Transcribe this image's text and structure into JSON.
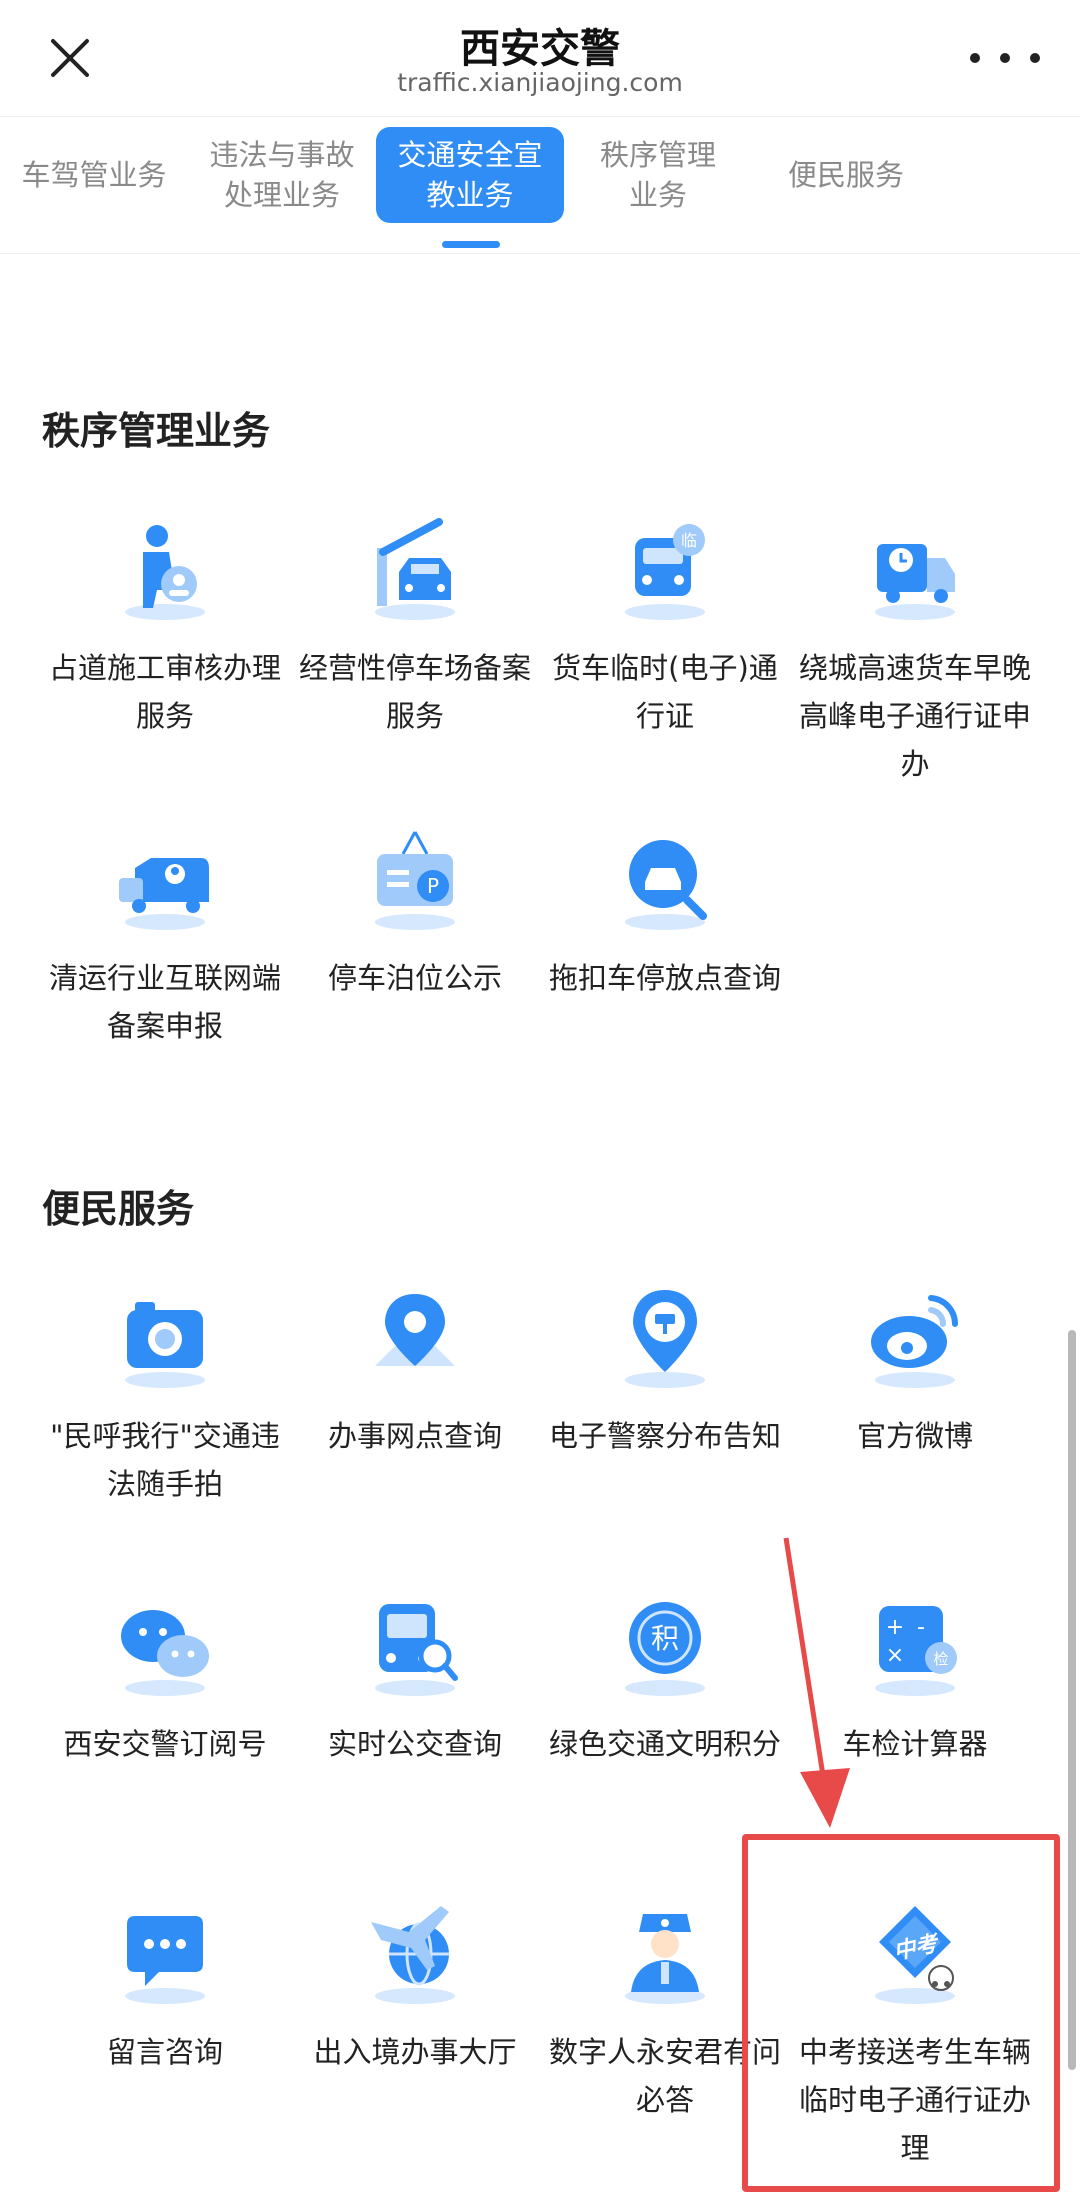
{
  "header": {
    "title": "西安交警",
    "url": "traffic.xianjiaojing.com"
  },
  "tabs": [
    {
      "label": "车驾管业务"
    },
    {
      "label": "违法与事故\n处理业务"
    },
    {
      "label": "交通安全宣\n教业务"
    },
    {
      "label": "秩序管理\n业务"
    },
    {
      "label": "便民服务"
    }
  ],
  "sections": [
    {
      "title": "秩序管理业务",
      "items": [
        {
          "label": "占道施工审核办理服务",
          "icon": "construction-worker-icon"
        },
        {
          "label": "经营性停车场备案服务",
          "icon": "parking-gate-icon"
        },
        {
          "label": "货车临时(电子)通行证",
          "icon": "truck-temp-pass-icon"
        },
        {
          "label": "绕城高速货车早晚高峰电子通行证申办",
          "icon": "truck-clock-icon"
        },
        {
          "label": "清运行业互联网端备案申报",
          "icon": "garbage-truck-icon"
        },
        {
          "label": "停车泊位公示",
          "icon": "parking-sign-icon"
        },
        {
          "label": "拖扣车停放点查询",
          "icon": "car-search-icon"
        }
      ]
    },
    {
      "title": "便民服务",
      "items": [
        {
          "label": "\"民呼我行\"交通违法随手拍",
          "icon": "camera-icon"
        },
        {
          "label": "办事网点查询",
          "icon": "location-pin-icon"
        },
        {
          "label": "电子警察分布告知",
          "icon": "traffic-camera-pin-icon"
        },
        {
          "label": "官方微博",
          "icon": "weibo-icon"
        },
        {
          "label": "西安交警订阅号",
          "icon": "wechat-icon"
        },
        {
          "label": "实时公交查询",
          "icon": "bus-search-icon"
        },
        {
          "label": "绿色交通文明积分",
          "icon": "points-icon"
        },
        {
          "label": "车检计算器",
          "icon": "calculator-icon"
        },
        {
          "label": "留言咨询",
          "icon": "message-icon"
        },
        {
          "label": "出入境办事大厅",
          "icon": "airplane-globe-icon"
        },
        {
          "label": "数字人永安君有问必答",
          "icon": "digital-officer-icon"
        },
        {
          "label": "中考接送考生车辆临时电子通行证办理",
          "icon": "zhongkao-icon",
          "icon_text": "中考"
        }
      ]
    }
  ],
  "colors": {
    "accent": "#2f8df5",
    "annotation": "#e84a4a"
  }
}
